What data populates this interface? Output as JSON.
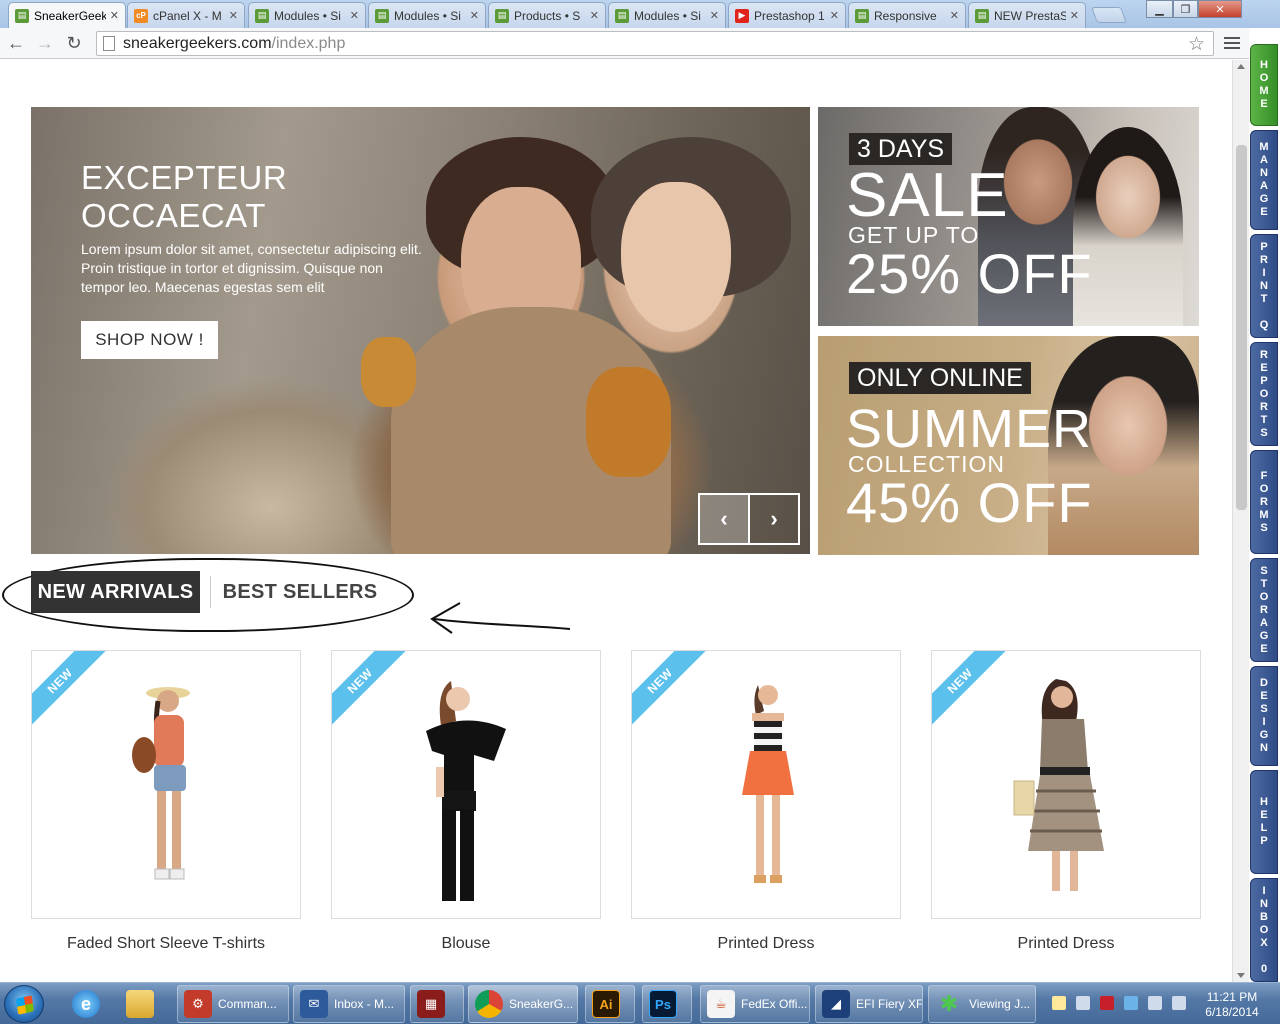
{
  "browser": {
    "tabs": [
      {
        "label": "SneakerGeek",
        "favicon": "prestashop-icon",
        "active": true
      },
      {
        "label": "cPanel X - M",
        "favicon": "cpanel-icon"
      },
      {
        "label": "Modules • Si",
        "favicon": "prestashop-icon"
      },
      {
        "label": "Modules • Si",
        "favicon": "prestashop-icon"
      },
      {
        "label": "Products • S",
        "favicon": "prestashop-icon"
      },
      {
        "label": "Modules • Si",
        "favicon": "prestashop-icon"
      },
      {
        "label": "Prestashop 1",
        "favicon": "youtube-icon"
      },
      {
        "label": "Responsive",
        "favicon": "prestashop-icon"
      },
      {
        "label": "NEW PrestaS",
        "favicon": "prestashop-icon"
      }
    ],
    "url_host": "sneakergeekers.com",
    "url_path": "/index.php"
  },
  "hero": {
    "title_line1": "EXCEPTEUR",
    "title_line2": "OCCAECAT",
    "text": "Lorem ipsum dolor sit amet, consectetur adipiscing elit. Proin tristique in tortor et dignissim. Quisque non tempor leo. Maecenas egestas sem elit",
    "button": "SHOP NOW !",
    "prev": "‹",
    "next": "›"
  },
  "banner_sale": {
    "tag": "3 DAYS",
    "big": "SALE",
    "small": "GET UP TO",
    "discount": "25% OFF"
  },
  "banner_summer": {
    "tag": "ONLY ONLINE",
    "big": "SUMMER",
    "small": "COLLECTION",
    "discount": "45% OFF"
  },
  "product_tabs": {
    "new_arrivals": "NEW ARRIVALS",
    "best_sellers": "BEST SELLERS"
  },
  "products": [
    {
      "name": "Faded Short Sleeve T-shirts",
      "badge": "NEW"
    },
    {
      "name": "Blouse",
      "badge": "NEW"
    },
    {
      "name": "Printed Dress",
      "badge": "NEW"
    },
    {
      "name": "Printed Dress",
      "badge": "NEW"
    }
  ],
  "admin_sidebar": [
    "HOME",
    "MANAGE",
    "PRINT Q",
    "REPORTS",
    "FORMS",
    "STORAGE",
    "DESIGN",
    "HELP",
    "INBOX 0"
  ],
  "taskbar": {
    "items": [
      {
        "label": "Comman...",
        "icon": "command-icon"
      },
      {
        "label": "Inbox - M...",
        "icon": "thunderbird-icon"
      },
      {
        "label": "",
        "icon": "app-icon"
      },
      {
        "label": "SneakerG...",
        "icon": "chrome-icon"
      },
      {
        "label": "Ai",
        "icon": "illustrator-icon"
      },
      {
        "label": "Ps",
        "icon": "photoshop-icon"
      },
      {
        "label": "FedEx Offi...",
        "icon": "java-icon"
      },
      {
        "label": "EFI Fiery XF",
        "icon": "efi-icon"
      },
      {
        "label": "Viewing J...",
        "icon": "viewer-icon"
      }
    ],
    "time": "11:21 PM",
    "date": "6/18/2014"
  },
  "colors": {
    "ribbon": "#5bc0eb",
    "tab_active_bg": "#333333",
    "admin_blue": "#2f4c86",
    "admin_green": "#348f27"
  }
}
